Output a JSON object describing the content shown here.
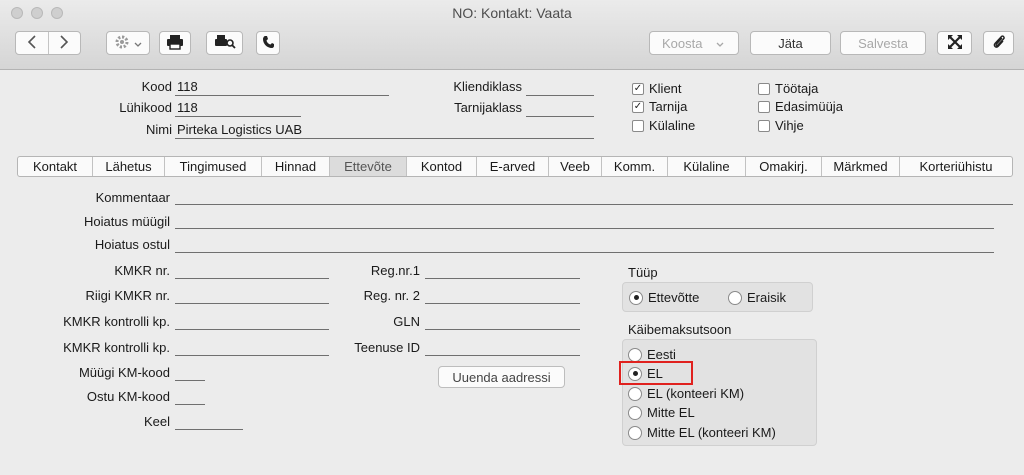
{
  "window": {
    "title": "NO: Kontakt: Vaata"
  },
  "toolbar": {
    "koosta_label": "Koosta",
    "jata_label": "Jäta",
    "salvesta_label": "Salvesta",
    "icons": [
      "arrow-left-icon",
      "arrow-right-icon",
      "gear-icon",
      "printer-icon",
      "print-preview-icon",
      "phone-icon",
      "expand-icon",
      "paperclip-icon"
    ]
  },
  "header": {
    "kood_label": "Kood",
    "kood_value": "118",
    "lyhikood_label": "Lühikood",
    "lyhikood_value": "118",
    "nimi_label": "Nimi",
    "nimi_value": "Pirteka Logistics UAB",
    "kliendiklass_label": "Kliendiklass",
    "kliendiklass_value": "",
    "tarnijaklass_label": "Tarnijaklass",
    "tarnijaklass_value": "",
    "checkboxes": [
      {
        "label": "Klient",
        "checked": true
      },
      {
        "label": "Tarnija",
        "checked": true
      },
      {
        "label": "Külaline",
        "checked": false
      },
      {
        "label": "Töötaja",
        "checked": false
      },
      {
        "label": "Edasimüüja",
        "checked": false
      },
      {
        "label": "Vihje",
        "checked": false
      }
    ]
  },
  "tabs": [
    {
      "label": "Kontakt"
    },
    {
      "label": "Lähetus"
    },
    {
      "label": "Tingimused"
    },
    {
      "label": "Hinnad"
    },
    {
      "label": "Ettevõte",
      "active": true
    },
    {
      "label": "Kontod"
    },
    {
      "label": "E-arved"
    },
    {
      "label": "Veeb"
    },
    {
      "label": "Komm."
    },
    {
      "label": "Külaline"
    },
    {
      "label": "Omakirj."
    },
    {
      "label": "Märkmed"
    },
    {
      "label": "Korteriühistu"
    }
  ],
  "form": {
    "kommentaar_label": "Kommentaar",
    "hoiatus_myygil_label": "Hoiatus müügil",
    "hoiatus_ostul_label": "Hoiatus ostul",
    "kmkr_label": "KMKR nr.",
    "riigi_kmkr_label": "Riigi KMKR nr.",
    "kmkr_kontrolli_label": "KMKR kontrolli kp.",
    "kmkr_kontrolli2_label": "KMKR kontrolli kp.",
    "myygi_km_label": "Müügi KM-kood",
    "ostu_km_label": "Ostu KM-kood",
    "keel_label": "Keel",
    "regnr1_label": "Reg.nr.1",
    "regnr2_label": "Reg. nr. 2",
    "gln_label": "GLN",
    "teenuse_id_label": "Teenuse ID",
    "uuenda_label": "Uuenda aadressi"
  },
  "tyyp": {
    "label": "Tüüp",
    "options": [
      {
        "label": "Ettevõtte",
        "selected": true
      },
      {
        "label": "Eraisik",
        "selected": false
      }
    ]
  },
  "kaibemaks": {
    "label": "Käibemaksutsoon",
    "options": [
      {
        "label": "Eesti",
        "selected": false
      },
      {
        "label": "EL",
        "selected": true
      },
      {
        "label": "EL (konteeri KM)",
        "selected": false
      },
      {
        "label": "Mitte EL",
        "selected": false
      },
      {
        "label": "Mitte EL (konteeri KM)",
        "selected": false
      }
    ]
  },
  "colors": {
    "highlight": "#e0211e"
  }
}
